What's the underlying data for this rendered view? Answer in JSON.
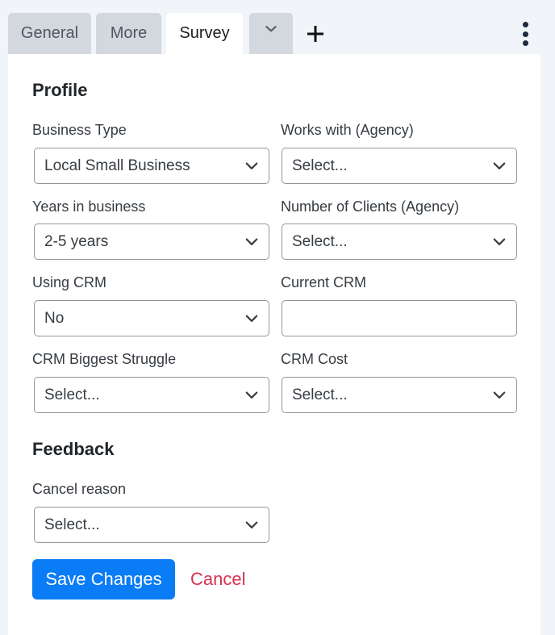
{
  "tabs": [
    {
      "label": "General",
      "active": false
    },
    {
      "label": "More",
      "active": false
    },
    {
      "label": "Survey",
      "active": true
    }
  ],
  "tab_icons": {
    "dropdown": "chevron-down-icon",
    "add": "plus-icon",
    "menu": "kebab-menu-icon"
  },
  "profile": {
    "title": "Profile",
    "fields": {
      "business_type": {
        "label": "Business Type",
        "value": "Local Small Business"
      },
      "works_with": {
        "label": "Works with (Agency)",
        "value": "Select..."
      },
      "years_in_business": {
        "label": "Years in business",
        "value": "2-5 years"
      },
      "number_of_clients": {
        "label": "Number of Clients (Agency)",
        "value": "Select..."
      },
      "using_crm": {
        "label": "Using CRM",
        "value": "No"
      },
      "current_crm": {
        "label": "Current CRM",
        "value": "",
        "placeholder": ""
      },
      "crm_biggest_struggle": {
        "label": "CRM Biggest Struggle",
        "value": "Select..."
      },
      "crm_cost": {
        "label": "CRM Cost",
        "value": "Select..."
      }
    }
  },
  "feedback": {
    "title": "Feedback",
    "fields": {
      "cancel_reason": {
        "label": "Cancel reason",
        "value": "Select..."
      }
    }
  },
  "actions": {
    "save_label": "Save Changes",
    "cancel_label": "Cancel"
  },
  "colors": {
    "primary": "#0a7cf5",
    "danger": "#d63150",
    "tab_inactive": "#d3d8de",
    "page_bg": "#f1f4f8"
  }
}
